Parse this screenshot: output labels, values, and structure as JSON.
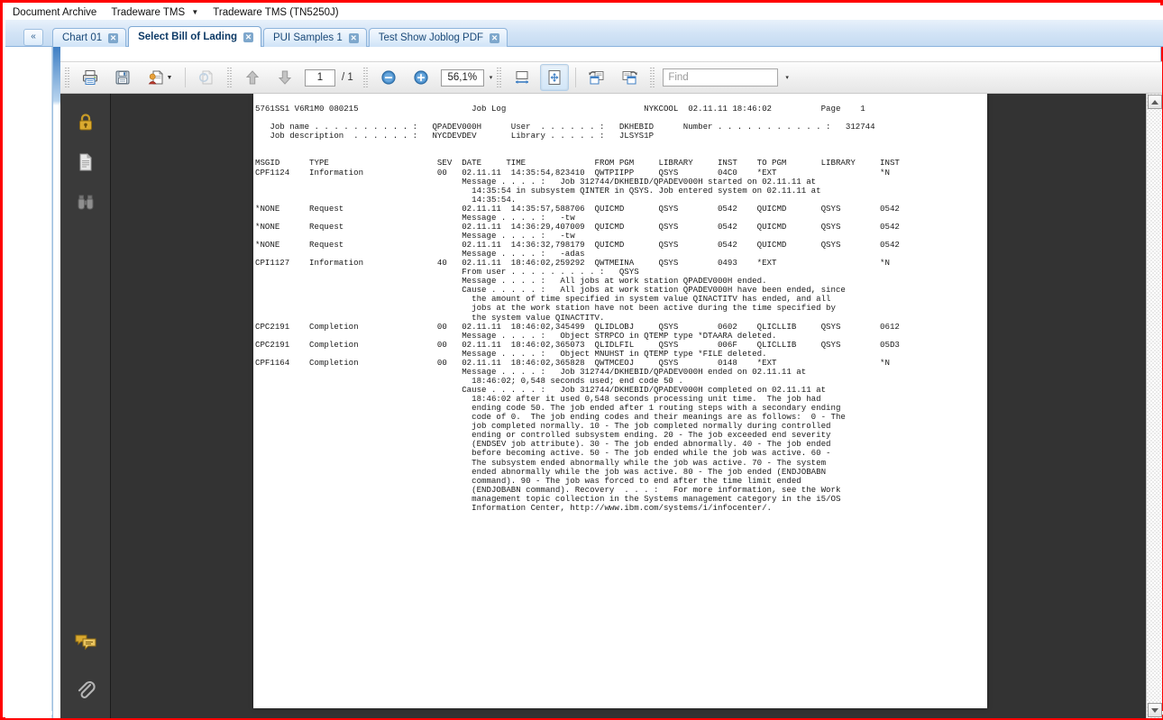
{
  "menubar": {
    "items": [
      {
        "label": "Document Archive",
        "has_caret": false
      },
      {
        "label": "Tradeware TMS",
        "has_caret": true
      },
      {
        "label": "Tradeware TMS (TN5250J)",
        "has_caret": false
      }
    ]
  },
  "tabstrip": {
    "collapse_label": "«",
    "close_glyph": "✕",
    "tabs": [
      {
        "label": "Chart 01",
        "active": false
      },
      {
        "label": "Select Bill of Lading",
        "active": true
      },
      {
        "label": "PUI Samples 1",
        "active": false
      },
      {
        "label": "Test Show Joblog PDF",
        "active": false
      }
    ]
  },
  "toolbar": {
    "print_label": "Print",
    "save_label": "Save",
    "export_label": "Export",
    "refresh_label": "Refresh",
    "prev_page_label": "Previous page",
    "next_page_label": "Next page",
    "page_number": "1",
    "page_total": "/ 1",
    "zoom_out_label": "Zoom out",
    "zoom_in_label": "Zoom in",
    "zoom_value": "56,1%",
    "zoom_caret": "▾",
    "fit_width_label": "Fit width",
    "fit_page_label": "Fit page",
    "rotate_left_label": "Rotate left",
    "rotate_right_label": "Rotate right",
    "find_placeholder": "Find",
    "find_value": "",
    "find_caret": "▾"
  },
  "sidebar": {
    "items": [
      {
        "name": "security-lock",
        "label": "Security"
      },
      {
        "name": "pages-thumbnail",
        "label": "Pages"
      },
      {
        "name": "search-binoculars",
        "label": "Search"
      },
      {
        "name": "comments",
        "label": "Comments"
      },
      {
        "name": "attachments",
        "label": "Attachments"
      }
    ]
  },
  "scrollbar": {
    "up_label": "Scroll up",
    "down_label": "Scroll down"
  },
  "document": {
    "title": "Job Log",
    "text": "5761SS1 V6R1M0 080215                       Job Log                            NYKCOOL  02.11.11 18:46:02          Page    1\n\n   Job name . . . . . . . . . . :   QPADEV000H      User  . . . . . . :   DKHEBID      Number . . . . . . . . . . . :   312744\n   Job description  . . . . . . :   NYCDEVDEV       Library . . . . . :   JLSYS1P\n\n\nMSGID      TYPE                      SEV  DATE     TIME              FROM PGM     LIBRARY     INST    TO PGM       LIBRARY     INST\nCPF1124    Information               00   02.11.11  14:35:54,823410  QWTPIIPP     QSYS        04C0    *EXT                     *N\n                                          Message . . . . :   Job 312744/DKHEBID/QPADEV000H started on 02.11.11 at\n                                            14:35:54 in subsystem QINTER in QSYS. Job entered system on 02.11.11 at\n                                            14:35:54.\n*NONE      Request                        02.11.11  14:35:57,588706  QUICMD       QSYS        0542    QUICMD       QSYS        0542\n                                          Message . . . . :   -tw\n*NONE      Request                        02.11.11  14:36:29,407009  QUICMD       QSYS        0542    QUICMD       QSYS        0542\n                                          Message . . . . :   -tw\n*NONE      Request                        02.11.11  14:36:32,798179  QUICMD       QSYS        0542    QUICMD       QSYS        0542\n                                          Message . . . . :   -adas\nCPI1127    Information               40   02.11.11  18:46:02,259292  QWTMEINA     QSYS        0493    *EXT                     *N\n                                          From user . . . . . . . . . :   QSYS\n                                          Message . . . . :   All jobs at work station QPADEV000H ended.\n                                          Cause . . . . . :   All jobs at work station QPADEV000H have been ended, since\n                                            the amount of time specified in system value QINACTITV has ended, and all\n                                            jobs at the work station have not been active during the time specified by\n                                            the system value QINACTITV.\nCPC2191    Completion                00   02.11.11  18:46:02,345499  QLIDLOBJ     QSYS        0602    QLICLLIB     QSYS        0612\n                                          Message . . . . :   Object STRPCO in QTEMP type *DTAARA deleted.\nCPC2191    Completion                00   02.11.11  18:46:02,365073  QLIDLFIL     QSYS        006F    QLICLLIB     QSYS        05D3\n                                          Message . . . . :   Object MNUHST in QTEMP type *FILE deleted.\nCPF1164    Completion                00   02.11.11  18:46:02,365828  QWTMCEOJ     QSYS        0148    *EXT                     *N\n                                          Message . . . . :   Job 312744/DKHEBID/QPADEV000H ended on 02.11.11 at\n                                            18:46:02; 0,548 seconds used; end code 50 .\n                                          Cause . . . . . :   Job 312744/DKHEBID/QPADEV000H completed on 02.11.11 at\n                                            18:46:02 after it used 0,548 seconds processing unit time.  The job had\n                                            ending code 50. The job ended after 1 routing steps with a secondary ending\n                                            code of 0.  The job ending codes and their meanings are as follows:  0 - The\n                                            job completed normally. 10 - The job completed normally during controlled\n                                            ending or controlled subsystem ending. 20 - The job exceeded end severity\n                                            (ENDSEV job attribute). 30 - The job ended abnormally. 40 - The job ended\n                                            before becoming active. 50 - The job ended while the job was active. 60 -\n                                            The subsystem ended abnormally while the job was active. 70 - The system\n                                            ended abnormally while the job was active. 80 - The job ended (ENDJOBABN\n                                            command). 90 - The job was forced to end after the time limit ended\n                                            (ENDJOBABN command). Recovery  . . . :   For more information, see the Work\n                                            management topic collection in the Systems management category in the i5/OS\n                                            Information Center, http://www.ibm.com/systems/i/infocenter/."
  }
}
